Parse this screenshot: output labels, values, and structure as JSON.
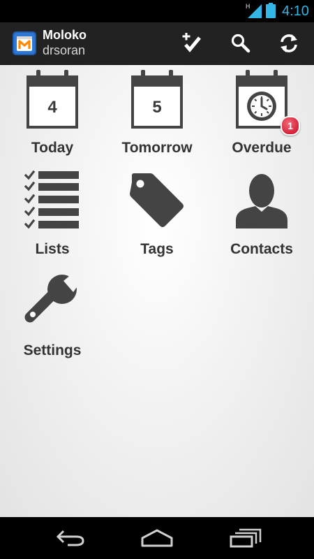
{
  "status_bar": {
    "network_type": "H",
    "time": "4:10",
    "accent_color": "#33b5e5"
  },
  "action_bar": {
    "title": "Moloko",
    "subtitle": "drsoran",
    "actions": [
      {
        "icon": "add-task-icon"
      },
      {
        "icon": "search-icon"
      },
      {
        "icon": "sync-icon"
      }
    ]
  },
  "dashboard": {
    "today": {
      "label": "Today",
      "day": "4"
    },
    "tomorrow": {
      "label": "Tomorrow",
      "day": "5"
    },
    "overdue": {
      "label": "Overdue",
      "badge": "1"
    },
    "lists": {
      "label": "Lists"
    },
    "tags": {
      "label": "Tags"
    },
    "contacts": {
      "label": "Contacts"
    },
    "settings": {
      "label": "Settings"
    }
  },
  "nav_bar": {
    "buttons": [
      {
        "icon": "back-icon"
      },
      {
        "icon": "home-icon"
      },
      {
        "icon": "recent-apps-icon"
      }
    ]
  },
  "colors": {
    "icon_gray": "#444444",
    "label_gray": "#333333",
    "badge_red": "#d6243b"
  }
}
